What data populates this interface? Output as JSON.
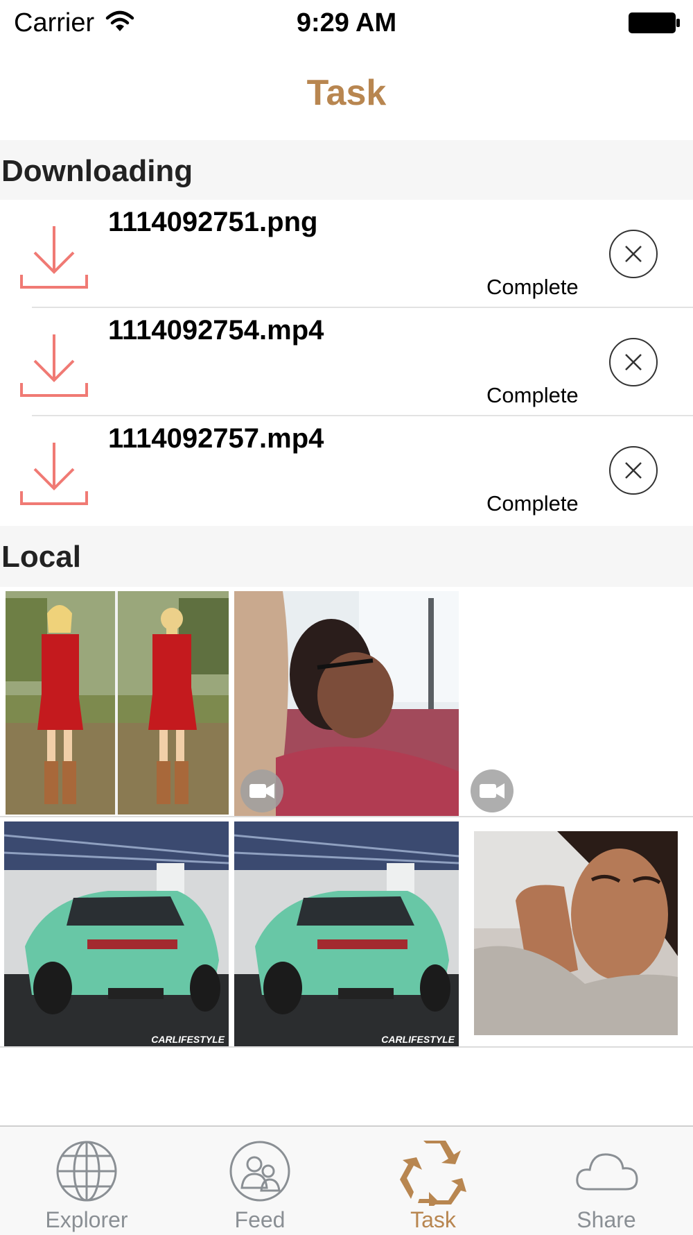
{
  "status_bar": {
    "carrier": "Carrier",
    "time": "9:29 AM"
  },
  "nav": {
    "title": "Task"
  },
  "sections": {
    "downloading": "Downloading",
    "local": "Local"
  },
  "downloads": [
    {
      "name": "1114092751.png",
      "status": "Complete"
    },
    {
      "name": "1114092754.mp4",
      "status": "Complete"
    },
    {
      "name": "1114092757.mp4",
      "status": "Complete"
    }
  ],
  "local_items": [
    {
      "kind": "photo",
      "subject": "red-dress-front-back"
    },
    {
      "kind": "video",
      "subject": "selfie-video"
    },
    {
      "kind": "video",
      "subject": "blank-video"
    },
    {
      "kind": "photo",
      "subject": "green-car",
      "watermark": "CARLIFESTYLE"
    },
    {
      "kind": "photo",
      "subject": "green-car",
      "watermark": "CARLIFESTYLE"
    },
    {
      "kind": "photo",
      "subject": "woman-portrait"
    }
  ],
  "tabs": [
    {
      "label": "Explorer",
      "icon": "globe-icon",
      "active": false
    },
    {
      "label": "Feed",
      "icon": "people-icon",
      "active": false
    },
    {
      "label": "Task",
      "icon": "recycle-icon",
      "active": true
    },
    {
      "label": "Share",
      "icon": "cloud-icon",
      "active": false
    }
  ],
  "colors": {
    "accent": "#b88650",
    "download_icon": "#f07a74",
    "tab_inactive": "#8a8f94"
  }
}
